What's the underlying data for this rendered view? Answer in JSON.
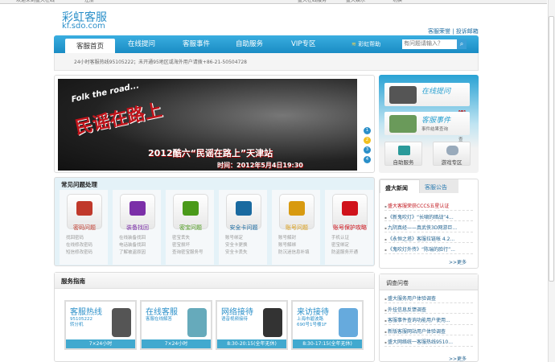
{
  "topbar": {
    "welcome": "欢迎来到盛大在线",
    "register": "注册",
    "service_menu": "盛大在线服务",
    "ent_menu": "盛大娱乐",
    "switch": "切换"
  },
  "header": {
    "logo_cn": "彩虹客服",
    "logo_en": "kf.sdo.com",
    "links": [
      "客服荣誉",
      "投诉邮箱"
    ]
  },
  "nav": {
    "items": [
      "客服首页",
      "在线提问",
      "客服事件",
      "自助服务",
      "VIP专区"
    ],
    "active": 0,
    "help": "彩虹帮助",
    "search_placeholder": "有问题请输入？",
    "search_icon": "search-icon"
  },
  "notice": "24小时客服热线95105222；未开通95地区或海外用户请拨+86-21-50504728",
  "banner": {
    "subtitle": "Folk the road...",
    "title": "民谣在路上",
    "line1": "2012酷六“民谣在路上”天津站",
    "line2": "时间：2012年5月4日19:30",
    "pages": [
      "1",
      "2",
      "3",
      "4"
    ],
    "active_page": 1
  },
  "common": {
    "title": "常见问题处理",
    "cards": [
      {
        "name": "密码问题",
        "color": "#c0392b",
        "icon": "lock-icon",
        "links": [
          "找回密码",
          "在线修改密码",
          "短信修改密码"
        ]
      },
      {
        "name": "装备找回",
        "color": "#7b2fa8",
        "icon": "cart-icon",
        "links": [
          "在线装备找回",
          "电话装备找回",
          "了解被盗原因"
        ]
      },
      {
        "name": "密宝问题",
        "color": "#4a9a1a",
        "icon": "token-icon",
        "links": [
          "密宝丢失",
          "密宝损坏",
          "查询密宝服务号"
        ]
      },
      {
        "name": "安全卡问题",
        "color": "#1a6aa0",
        "icon": "card-icon",
        "links": [
          "账号绑定",
          "安全卡更换",
          "安全卡丢失"
        ]
      },
      {
        "name": "账号问题",
        "color": "#d89a10",
        "icon": "key-icon",
        "links": [
          "账号解封",
          "账号解绑",
          "防沉迷信息补填"
        ]
      },
      {
        "name": "账号保护攻略",
        "color": "#d0121b",
        "icon": "alert-icon",
        "links": [
          "手机认证",
          "密宝绑定",
          "防盗服务开通"
        ]
      }
    ]
  },
  "guide": {
    "title": "服务指南",
    "cards": [
      {
        "title": "客服热线",
        "sub": [
          "95105222",
          "转分机"
        ],
        "hours": "7×24小时",
        "icon": "phone-icon"
      },
      {
        "title": "在线客服",
        "sub": [
          "客服在线解答"
        ],
        "hours": "7×24小时",
        "icon": "chat-icon"
      },
      {
        "title": "网络接待",
        "sub": [
          "语音视频接待"
        ],
        "hours": "8:30-20:15(全年无休)",
        "icon": "headset-icon"
      },
      {
        "title": "来访接待",
        "sub": [
          "上海市碧波路",
          "690号1号楼1F"
        ],
        "hours": "8:30-17:15(全年无休)",
        "icon": "building-icon"
      }
    ]
  },
  "right": {
    "ask": {
      "title": "在线提问",
      "sub": "提问结果查询",
      "count": "[0]"
    },
    "event": {
      "title": "客服事件",
      "sub": "事件结果查询"
    },
    "self": "自助服务",
    "game": "游戏专区"
  },
  "news": {
    "tabs": [
      "盛大新闻",
      "客服公告"
    ],
    "items": [
      "盛大客服荣获CCCS五星认证",
      "《新鬼吹灯》“长啸的暗战”4...",
      "九阴真经——真武侠3D网游巨...",
      "《永恒之塔》客服拉链帐 4.2...",
      "《鬼吹灯外传》“陈瑞的脸行”..."
    ],
    "more": ">>更多"
  },
  "survey": {
    "title": "调查问卷",
    "items": [
      "盛大服务用户体验调查",
      "外挂信息反馈调查",
      "客服事件查询功能用户使用...",
      "新版客服网站用户体验调查",
      "盛大网络统一客服热线9510..."
    ],
    "more": ">>更多"
  }
}
